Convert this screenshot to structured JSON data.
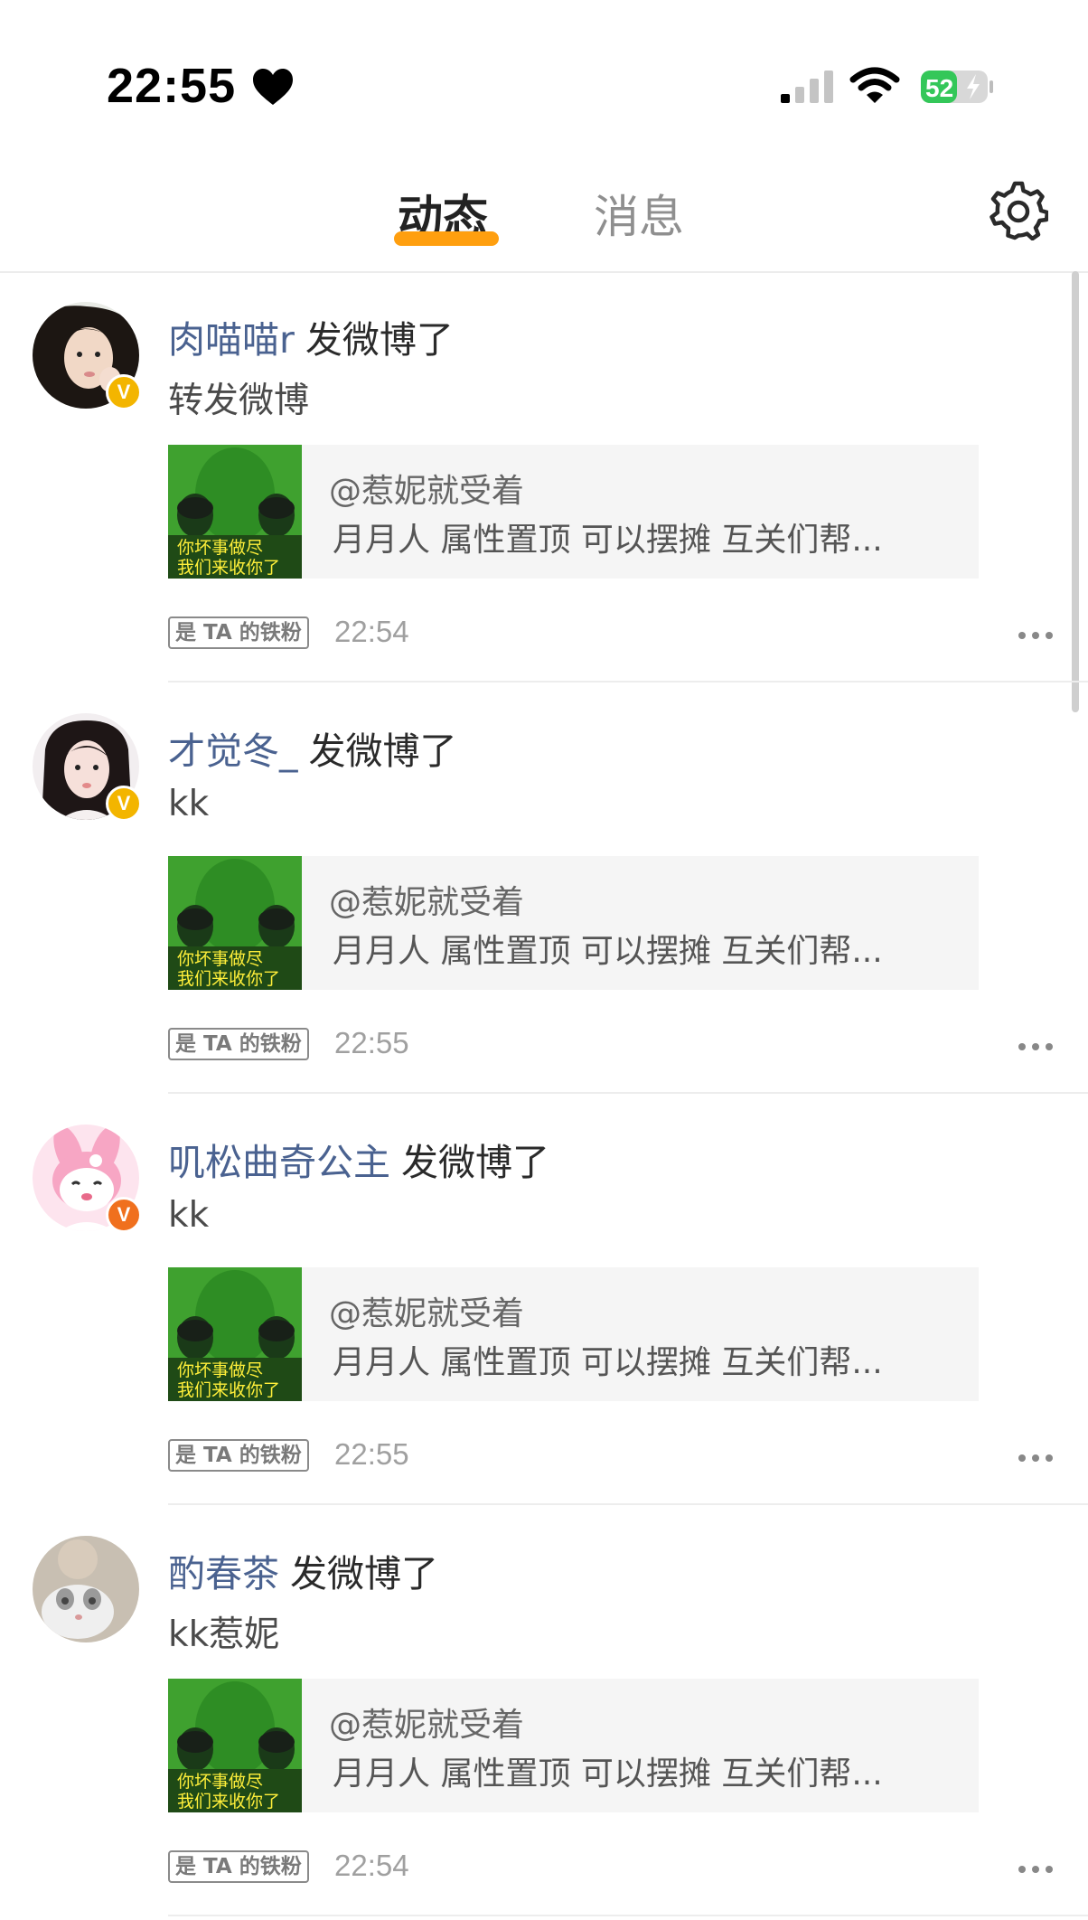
{
  "status_bar": {
    "time": "22:55",
    "battery": "52"
  },
  "header": {
    "tabs": [
      {
        "label": "动态"
      },
      {
        "label": "消息"
      }
    ]
  },
  "posts": [
    {
      "username": "肉喵喵r",
      "action": "发微博了",
      "text": "转发微博",
      "card_author": "@惹妮就受着",
      "card_desc": "月月人 属性置顶 可以摆摊 互关们帮...",
      "thumb_caption_1": "你坏事做尽",
      "thumb_caption_2": "我们来收你了",
      "fan_badge": "是 TA 的铁粉",
      "time": "22:54",
      "verified_color": "gold"
    },
    {
      "username": "才觉冬_",
      "action": "发微博了",
      "text": "kk",
      "card_author": "@惹妮就受着",
      "card_desc": "月月人 属性置顶 可以摆摊 互关们帮...",
      "thumb_caption_1": "你坏事做尽",
      "thumb_caption_2": "我们来收你了",
      "fan_badge": "是 TA 的铁粉",
      "time": "22:55",
      "verified_color": "gold"
    },
    {
      "username": "叽松曲奇公主",
      "action": "发微博了",
      "text": "kk",
      "card_author": "@惹妮就受着",
      "card_desc": "月月人 属性置顶 可以摆摊 互关们帮...",
      "thumb_caption_1": "你坏事做尽",
      "thumb_caption_2": "我们来收你了",
      "fan_badge": "是 TA 的铁粉",
      "time": "22:55",
      "verified_color": "orange"
    },
    {
      "username": "酌春茶",
      "action": "发微博了",
      "text": "kk惹妮",
      "card_author": "@惹妮就受着",
      "card_desc": "月月人 属性置顶 可以摆摊 互关们帮...",
      "thumb_caption_1": "你坏事做尽",
      "thumb_caption_2": "我们来收你了",
      "fan_badge": "是 TA 的铁粉",
      "time": "22:54",
      "verified_color": "none"
    }
  ],
  "icons": {
    "heart": "heart-icon",
    "signal": "cellular-signal-icon",
    "wifi": "wifi-icon",
    "battery": "battery-charging-icon",
    "settings": "gear-icon",
    "more": "more-dots-icon"
  },
  "colors": {
    "accent": "#ff9f0f",
    "username": "#4a6290",
    "battery_green": "#34c759"
  }
}
